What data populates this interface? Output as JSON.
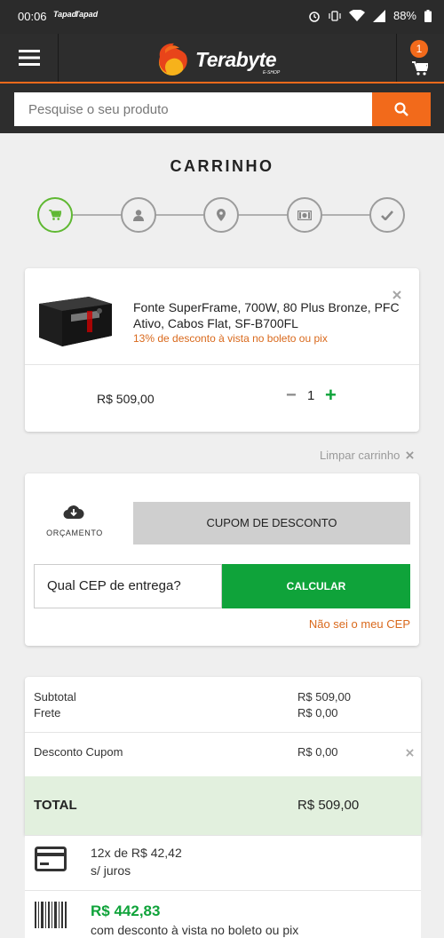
{
  "status_bar": {
    "time": "00:06",
    "notif_1": "Tapad",
    "notif_2": "Tapad",
    "battery": "88%"
  },
  "header": {
    "logo_text": "Terabyte",
    "logo_sub": "E-SHOP",
    "cart_count": "1"
  },
  "search": {
    "placeholder": "Pesquise o seu produto"
  },
  "page": {
    "title": "CARRINHO"
  },
  "steps": [
    "cart-icon",
    "user-icon",
    "location-pin-icon",
    "money-icon",
    "check-icon"
  ],
  "product": {
    "name": "Fonte SuperFrame, 700W, 80 Plus Bronze, PFC Ativo, Cabos Flat, SF-B700FL",
    "discount": "13% de desconto à vista no boleto ou pix",
    "price": "R$ 509,00",
    "quantity": "1",
    "minus": "−",
    "plus": "+"
  },
  "clear_cart": "Limpar carrinho",
  "shipping": {
    "orcamento_label": "ORÇAMENTO",
    "cupom_label": "CUPOM DE DESCONTO",
    "cep_placeholder": "Qual CEP de entrega?",
    "calc_label": "CALCULAR",
    "nao_sei": "Não sei o meu CEP"
  },
  "summary": {
    "subtotal_label": "Subtotal",
    "subtotal_value": "R$ 509,00",
    "frete_label": "Frete",
    "frete_value": "R$ 0,00",
    "desconto_label": "Desconto Cupom",
    "desconto_value": "R$ 0,00",
    "total_label": "TOTAL",
    "total_value": "R$ 509,00"
  },
  "payment": {
    "installments": "12x de R$ 42,42",
    "no_interest": "s/ juros",
    "cash_price": "R$ 442,83",
    "cash_desc": "com desconto à vista no boleto ou pix"
  },
  "colors": {
    "accent": "#f26a1b",
    "green": "#0fa33a",
    "active_step": "#5fb832",
    "header_bg": "#2d2d2d"
  }
}
